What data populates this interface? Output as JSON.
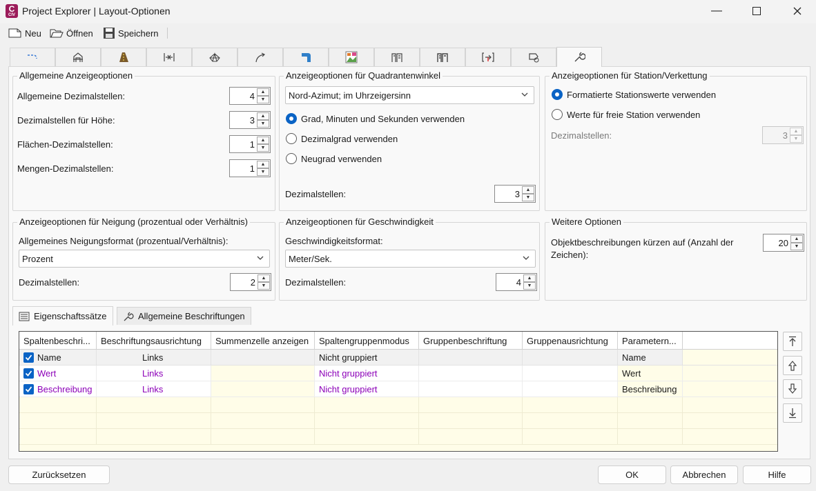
{
  "window": {
    "title": "Project Explorer | Layout-Optionen",
    "app_icon_letter": "C",
    "app_icon_sub": "CIV"
  },
  "toolbar": {
    "new_label": "Neu",
    "open_label": "Öffnen",
    "save_label": "Speichern"
  },
  "top_tabs": [
    {
      "icon": "alignment-icon"
    },
    {
      "icon": "structure-icon"
    },
    {
      "icon": "road-icon"
    },
    {
      "icon": "profile-icon"
    },
    {
      "icon": "surface-icon"
    },
    {
      "icon": "corridor-icon"
    },
    {
      "icon": "pipe-icon"
    },
    {
      "icon": "image-icon"
    },
    {
      "icon": "section-icon"
    },
    {
      "icon": "section-view-icon"
    },
    {
      "icon": "station-icon"
    },
    {
      "icon": "label-icon"
    },
    {
      "icon": "wrench-icon",
      "active": true
    }
  ],
  "general": {
    "title": "Allgemeine Anzeigeoptionen",
    "rows": [
      {
        "label": "Allgemeine Dezimalstellen:",
        "value": "4"
      },
      {
        "label": "Dezimalstellen für Höhe:",
        "value": "3"
      },
      {
        "label": "Flächen-Dezimalstellen:",
        "value": "1"
      },
      {
        "label": "Mengen-Dezimalstellen:",
        "value": "1"
      }
    ]
  },
  "quadrant": {
    "title": "Anzeigeoptionen für Quadrantenwinkel",
    "format_selected": "Nord-Azimut; im Uhrzeigersinn",
    "options": [
      {
        "label": "Grad, Minuten und Sekunden verwenden",
        "checked": true
      },
      {
        "label": "Dezimalgrad verwenden",
        "checked": false
      },
      {
        "label": "Neugrad verwenden",
        "checked": false
      }
    ],
    "decimals_label": "Dezimalstellen:",
    "decimals_value": "3"
  },
  "station": {
    "title": "Anzeigeoptionen für Station/Verkettung",
    "options": [
      {
        "label": "Formatierte Stationswerte verwenden",
        "checked": true
      },
      {
        "label": "Werte für freie Station verwenden",
        "checked": false
      }
    ],
    "decimals_label": "Dezimalstellen:",
    "decimals_value": "3"
  },
  "slope": {
    "title": "Anzeigeoptionen für Neigung (prozentual oder Verhältnis)",
    "format_label": "Allgemeines Neigungsformat (prozentual/Verhältnis):",
    "format_selected": "Prozent",
    "decimals_label": "Dezimalstellen:",
    "decimals_value": "2"
  },
  "speed": {
    "title": "Anzeigeoptionen für Geschwindigkeit",
    "format_label": "Geschwindigkeitsformat:",
    "format_selected": "Meter/Sek.",
    "decimals_label": "Dezimalstellen:",
    "decimals_value": "4"
  },
  "other": {
    "title": "Weitere Optionen",
    "truncate_label_1": "Objektbeschreibungen kürzen auf (Anzahl der",
    "truncate_label_2": "Zeichen):",
    "truncate_value": "20"
  },
  "bottom_tabs": [
    {
      "label": "Eigenschaftssätze",
      "icon": "list-icon",
      "active": true
    },
    {
      "label": "Allgemeine Beschriftungen",
      "icon": "wrench-icon",
      "active": false
    }
  ],
  "grid": {
    "columns": [
      "Spaltenbeschri...",
      "Beschriftungsausrichtung",
      "Summenzelle anzeigen",
      "Spaltengruppenmodus",
      "Gruppenbeschriftung",
      "Gruppenausrichtung",
      "Parametern..."
    ],
    "rows": [
      {
        "checked": true,
        "name": "Name",
        "align": "Links",
        "sum": "",
        "mode": "Nicht gruppiert",
        "group_label": "",
        "group_align": "",
        "param": "Name"
      },
      {
        "checked": true,
        "name": "Wert",
        "align": "Links",
        "sum": "",
        "mode": "Nicht gruppiert",
        "group_label": "",
        "group_align": "",
        "param": "Wert"
      },
      {
        "checked": true,
        "name": "Beschreibung",
        "align": "Links",
        "sum": "",
        "mode": "Nicht gruppiert",
        "group_label": "",
        "group_align": "",
        "param": "Beschreibung"
      }
    ]
  },
  "side_buttons": [
    "move-top-icon",
    "move-up-icon",
    "move-down-icon",
    "move-bottom-icon"
  ],
  "footer": {
    "reset_label": "Zurücksetzen",
    "ok_label": "OK",
    "cancel_label": "Abbrechen",
    "help_label": "Hilfe"
  }
}
